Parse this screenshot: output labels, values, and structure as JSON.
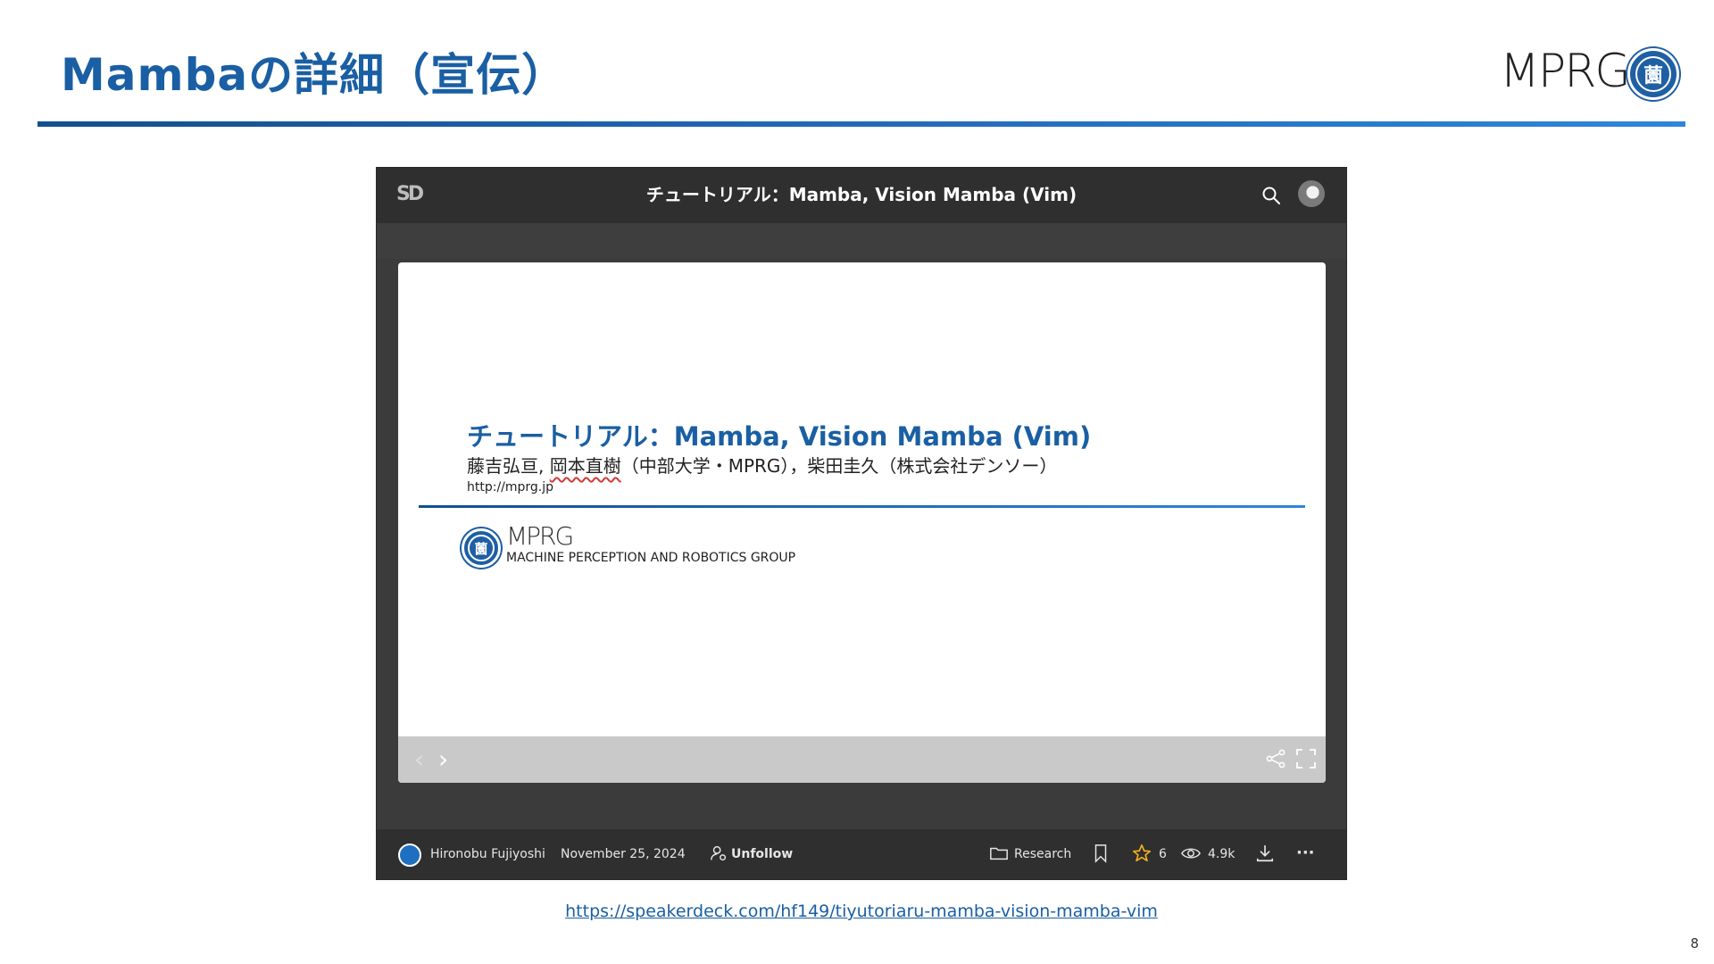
{
  "slide": {
    "title": "Mambaの詳細（宣伝）",
    "logo_text": "MPRG",
    "seal_glyph": "薗",
    "source_url": "https://speakerdeck.com/hf149/tiyutoriaru-mamba-vision-mamba-vim",
    "page_number": "8",
    "accent_color": "#1a5fa3"
  },
  "speakerdeck": {
    "logo": "SD",
    "title": "チュートリアル：Mamba, Vision Mamba (Vim)",
    "search_icon": "search-icon",
    "avatar_icon": "avatar"
  },
  "preview": {
    "title": "チュートリアル：Mamba, Vision Mamba (Vim)",
    "authors_prefix": "藤吉弘亘, ",
    "authors_highlight": "岡本直樹",
    "authors_suffix": "（中部大学・MPRG），柴田圭久（株式会社デンソー）",
    "url": "http://mprg.jp",
    "logo_text": "MPRG",
    "group_name": "MACHINE PERCEPTION AND ROBOTICS GROUP",
    "prev_arrow": "‹",
    "next_arrow": "›"
  },
  "info_bar": {
    "author": "Hironobu Fujiyoshi",
    "date": "November 25, 2024",
    "follow_label": "Unfollow",
    "category": "Research",
    "stars": "6",
    "views": "4.9k",
    "more": "···"
  }
}
